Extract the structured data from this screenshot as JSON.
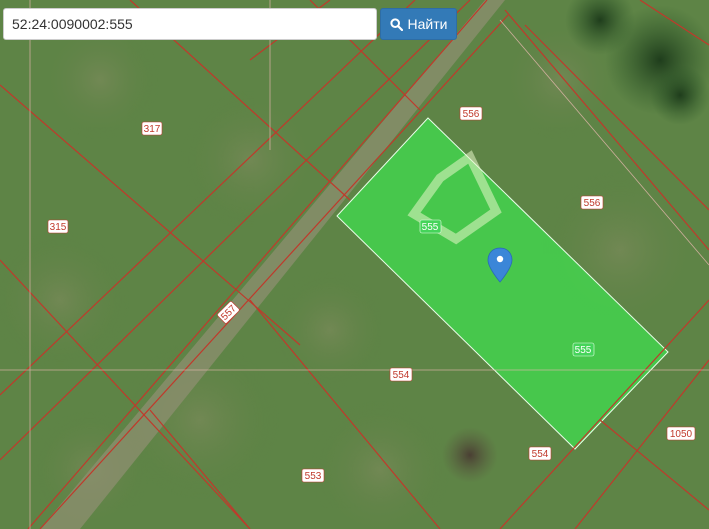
{
  "search": {
    "value": "52:24:0090002:555",
    "button_label": "Найти",
    "button_icon": "search-icon",
    "button_color": "#337ab7"
  },
  "map": {
    "selected_parcel_color": "#3ee04f",
    "boundary_color": "#c0392b",
    "marker_icon": "map-pin-icon",
    "marker_color": "#3b86d8",
    "parcel_labels": {
      "l317": "317",
      "l315": "315",
      "l557": "557",
      "l556a": "556",
      "l556b": "556",
      "l555a": "555",
      "l555b": "555",
      "l554a": "554",
      "l554b": "554",
      "l553": "553",
      "l1050": "1050"
    }
  }
}
